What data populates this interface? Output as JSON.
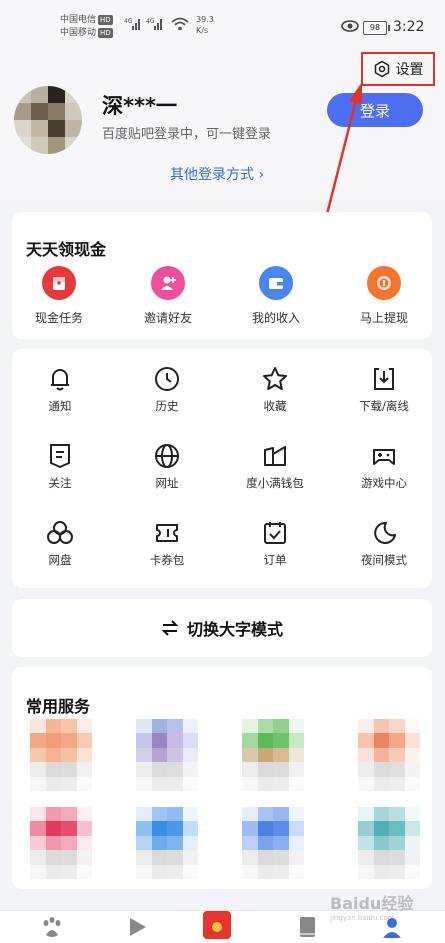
{
  "status_bar": {
    "carrier1": "中国电信",
    "carrier2": "中国移动",
    "hd": "HD",
    "net1": "4G",
    "net2": "4G",
    "speed_value": "39.3",
    "speed_unit": "K/s",
    "battery": "98",
    "time": "3:22"
  },
  "header": {
    "settings_label": "设置",
    "username": "深***一",
    "login_hint": "百度贴吧登录中，可一键登录",
    "login_button": "登录",
    "other_login": "其他登录方式 ›"
  },
  "cash_section": {
    "title": "天天领现金",
    "items": [
      {
        "label": "现金任务",
        "icon": "red-envelope-icon",
        "color": "#e63a3a"
      },
      {
        "label": "邀请好友",
        "icon": "add-friend-icon",
        "color": "#f04e9a"
      },
      {
        "label": "我的收入",
        "icon": "wallet-icon",
        "color": "#4a86f0"
      },
      {
        "label": "马上提现",
        "icon": "withdraw-icon",
        "color": "#f4742e"
      }
    ]
  },
  "tools": {
    "items": [
      {
        "label": "通知",
        "icon": "bell-icon"
      },
      {
        "label": "历史",
        "icon": "clock-icon"
      },
      {
        "label": "收藏",
        "icon": "star-icon"
      },
      {
        "label": "下载/离线",
        "icon": "download-icon"
      },
      {
        "label": "关注",
        "icon": "bookmark-icon"
      },
      {
        "label": "网址",
        "icon": "globe-icon"
      },
      {
        "label": "度小满钱包",
        "icon": "wallet-outline-icon"
      },
      {
        "label": "游戏中心",
        "icon": "gamepad-icon"
      },
      {
        "label": "网盘",
        "icon": "cloud-icon"
      },
      {
        "label": "卡券包",
        "icon": "ticket-icon"
      },
      {
        "label": "订单",
        "icon": "calendar-check-icon"
      },
      {
        "label": "夜间模式",
        "icon": "moon-icon"
      }
    ]
  },
  "big_font_mode": {
    "label": "切换大字模式",
    "icon": "switch-arrows-icon"
  },
  "services": {
    "title": "常用服务"
  },
  "tab_bar": {
    "items": [
      {
        "icon": "baidu-paw-icon"
      },
      {
        "icon": "video-play-icon"
      },
      {
        "icon": "red-packet-tab-icon"
      },
      {
        "icon": "book-icon"
      },
      {
        "icon": "profile-icon"
      }
    ]
  },
  "watermark": {
    "brand": "Baidu经验",
    "url": "jingyan.baidu.com"
  }
}
